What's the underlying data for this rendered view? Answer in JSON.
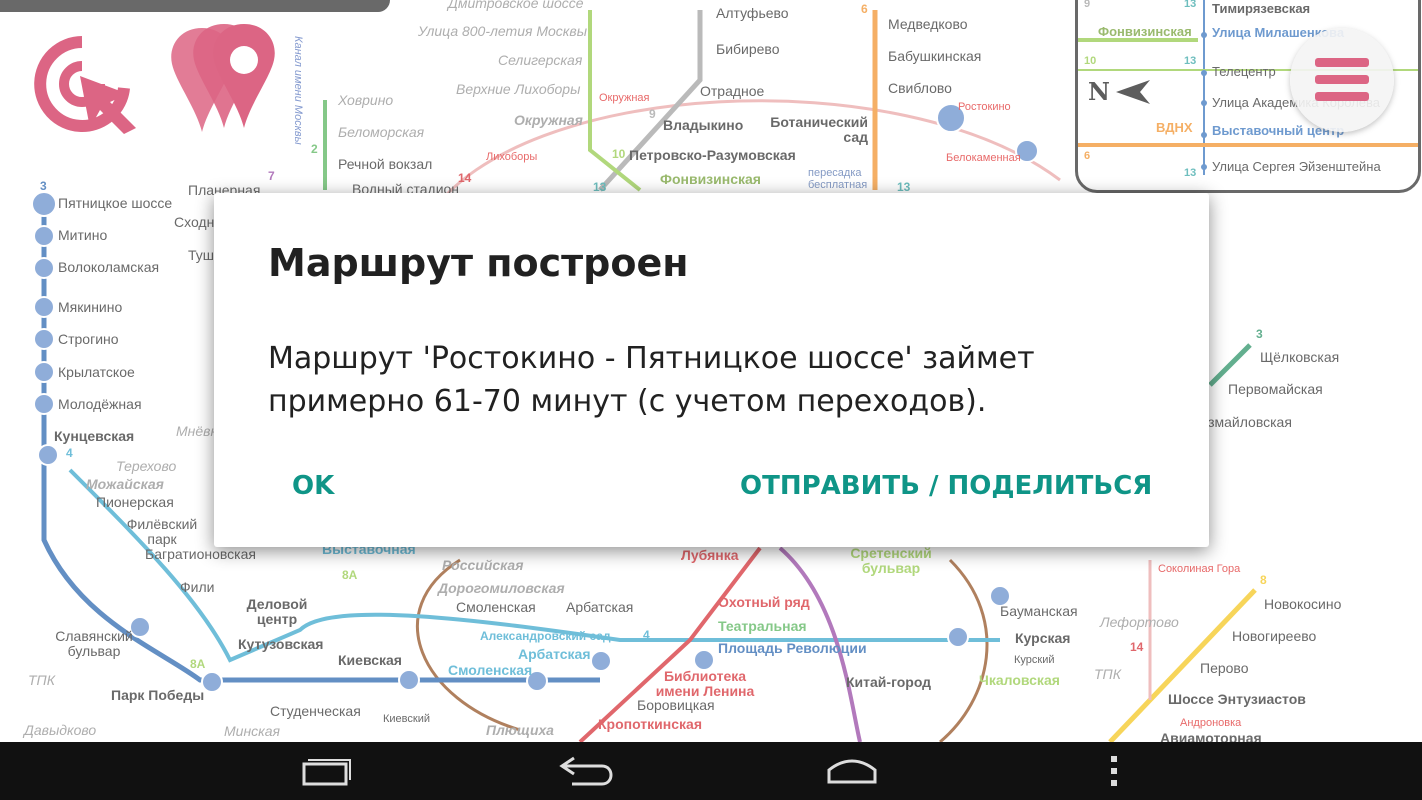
{
  "dialog": {
    "title": "Маршрут построен",
    "message": "Маршрут 'Ростокино - Пятницкое шоссе' займет примерно 61-70 минут (с учетом переходов).",
    "ok_label": "OK",
    "share_label": "ОТПРАВИТЬ / ПОДЕЛИТЬСЯ"
  },
  "colors": {
    "accent": "#0f9587",
    "brand": "#cc1d4a",
    "line_3": "#1a5aa8",
    "line_4": "#2ba0c8",
    "line_9": "#9a9a9a",
    "line_10": "#8dc63f",
    "line_6": "#f08a1c",
    "line_circle": "#8b4513",
    "line_1": "#d22027"
  },
  "icons": {
    "route": "route-cursor-icon",
    "markers": "map-markers-icon",
    "menu": "hamburger-menu-icon",
    "compass": "north-arrow-icon"
  },
  "inset": {
    "compass": "N",
    "stations": [
      {
        "name": "Тимирязевская",
        "bold": true
      },
      {
        "name": "Улица Милашенкова",
        "display": "Улица Милашенкова"
      },
      {
        "name": "Телецентр"
      },
      {
        "name": "Улица Академика Королёва"
      },
      {
        "name": "Выставочный центр"
      },
      {
        "name": "Улица Сергея Эйзенштейна"
      }
    ],
    "labels": [
      "Фонвизинская",
      "ВДНХ"
    ],
    "line_numbers": [
      "9",
      "13",
      "10",
      "13",
      "6",
      "13"
    ]
  },
  "map": {
    "stations": [
      {
        "text": "Дмитровское шоссе",
        "style": "i"
      },
      {
        "text": "Улица 800-летия Москвы",
        "style": "i"
      },
      {
        "text": "Селигерская",
        "style": "i"
      },
      {
        "text": "Верхние Лихоборы",
        "style": "i"
      },
      {
        "text": "Окружная",
        "style": "i"
      },
      {
        "text": "Ховрино",
        "style": "i"
      },
      {
        "text": "Беломорская",
        "style": "i"
      },
      {
        "text": "Речной вокзал",
        "style": ""
      },
      {
        "text": "Водный стадион",
        "style": ""
      },
      {
        "text": "Планерная",
        "style": ""
      },
      {
        "text": "Сходненская",
        "style": ""
      },
      {
        "text": "Тушинская",
        "style": ""
      },
      {
        "text": "Алтуфьево",
        "style": ""
      },
      {
        "text": "Бибирево",
        "style": ""
      },
      {
        "text": "Отрадное",
        "style": ""
      },
      {
        "text": "Владыкино",
        "style": "b"
      },
      {
        "text": "Петровско-Разумовская",
        "style": "b"
      },
      {
        "text": "Фонвизинская",
        "style": "b"
      },
      {
        "text": "Медведково",
        "style": ""
      },
      {
        "text": "Бабушкинская",
        "style": ""
      },
      {
        "text": "Свиблово",
        "style": ""
      },
      {
        "text": "Ботанический сад",
        "style": "b"
      },
      {
        "text": "Ростокино",
        "style": "r"
      },
      {
        "text": "Белокаменная",
        "style": "r"
      },
      {
        "text": "Лихоборы",
        "style": "r"
      },
      {
        "text": "Окружная",
        "style": "r"
      },
      {
        "text": "пересадка бесплатная",
        "style": "sm"
      },
      {
        "text": "Пятницкое шоссе",
        "style": ""
      },
      {
        "text": "Митино",
        "style": ""
      },
      {
        "text": "Волоколамская",
        "style": ""
      },
      {
        "text": "Мякинино",
        "style": ""
      },
      {
        "text": "Строгино",
        "style": ""
      },
      {
        "text": "Крылатское",
        "style": ""
      },
      {
        "text": "Молодёжная",
        "style": ""
      },
      {
        "text": "Кунцевская",
        "style": "b"
      },
      {
        "text": "Мнёвники",
        "style": "i"
      },
      {
        "text": "Терехово",
        "style": "i"
      },
      {
        "text": "Можайская",
        "style": "i"
      },
      {
        "text": "Пионерская",
        "style": ""
      },
      {
        "text": "Филёвский парк",
        "style": ""
      },
      {
        "text": "Багратионовская",
        "style": ""
      },
      {
        "text": "Фили",
        "style": ""
      },
      {
        "text": "Славянский бульвар",
        "style": ""
      },
      {
        "text": "ТПК",
        "style": "i"
      },
      {
        "text": "Парк Победы",
        "style": "b"
      },
      {
        "text": "Давыдково",
        "style": "i"
      },
      {
        "text": "Минская",
        "style": "i"
      },
      {
        "text": "Студенческая",
        "style": ""
      },
      {
        "text": "Кутузовская",
        "style": "b"
      },
      {
        "text": "Деловой центр",
        "style": "b"
      },
      {
        "text": "Выставочная",
        "style": "b"
      },
      {
        "text": "Российская",
        "style": "i"
      },
      {
        "text": "Дорогомиловская",
        "style": "i"
      },
      {
        "text": "Смоленская",
        "style": ""
      },
      {
        "text": "Арбатская",
        "style": ""
      },
      {
        "text": "Киевская",
        "style": "b"
      },
      {
        "text": "Киевский",
        "style": "sm"
      },
      {
        "text": "Смоленская",
        "style": "b"
      },
      {
        "text": "Александровский сад",
        "style": "b"
      },
      {
        "text": "Арбатская",
        "style": "b"
      },
      {
        "text": "Плющиха",
        "style": "i"
      },
      {
        "text": "Библиотека имени Ленина",
        "style": "b"
      },
      {
        "text": "Боровицкая",
        "style": ""
      },
      {
        "text": "Кропоткинская",
        "style": "b"
      },
      {
        "text": "Лубянка",
        "style": "b"
      },
      {
        "text": "Охотный ряд",
        "style": "b"
      },
      {
        "text": "Театральная",
        "style": "b"
      },
      {
        "text": "Площадь Революции",
        "style": "b"
      },
      {
        "text": "Сретенский бульвар",
        "style": "b"
      },
      {
        "text": "Китай-город",
        "style": "b"
      },
      {
        "text": "Бауманская",
        "style": ""
      },
      {
        "text": "Курская",
        "style": "b"
      },
      {
        "text": "Курский",
        "style": "sm"
      },
      {
        "text": "Чкаловская",
        "style": "b"
      },
      {
        "text": "Щёлковская",
        "style": ""
      },
      {
        "text": "Первомайская",
        "style": ""
      },
      {
        "text": "Измайловская",
        "style": ""
      },
      {
        "text": "Соколиная Гора",
        "style": "r"
      },
      {
        "text": "Новокосино",
        "style": ""
      },
      {
        "text": "Лефортово",
        "style": "i"
      },
      {
        "text": "Новогиреево",
        "style": ""
      },
      {
        "text": "Перово",
        "style": ""
      },
      {
        "text": "Шоссе Энтузиастов",
        "style": "b"
      },
      {
        "text": "Андроновка",
        "style": "r"
      },
      {
        "text": "Авиамоторная",
        "style": "b"
      },
      {
        "text": "Канал имени Москвы",
        "style": "i"
      }
    ],
    "line_numbers": [
      "3",
      "7",
      "2",
      "9",
      "10",
      "14",
      "13",
      "6",
      "13",
      "4",
      "8А",
      "8А",
      "4",
      "3",
      "8",
      "14",
      "ТПК"
    ]
  },
  "nav": {
    "recent": "recent-apps-icon",
    "back": "back-icon",
    "home": "home-icon",
    "more": "overflow-menu-icon"
  }
}
